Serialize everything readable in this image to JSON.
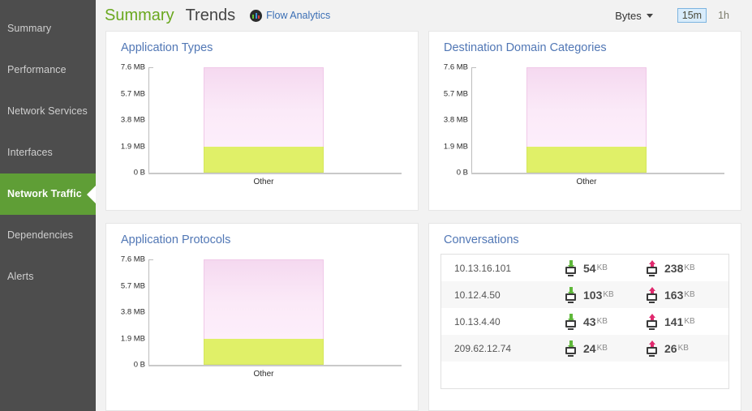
{
  "sidebar": {
    "items": [
      {
        "label": "Summary",
        "name": "summary",
        "active": false
      },
      {
        "label": "Performance",
        "name": "performance",
        "active": false
      },
      {
        "label": "Network Services",
        "name": "network-services",
        "active": false
      },
      {
        "label": "Interfaces",
        "name": "interfaces",
        "active": false
      },
      {
        "label": "Network Traffic",
        "name": "network-traffic",
        "active": true
      },
      {
        "label": "Dependencies",
        "name": "dependencies",
        "active": false
      },
      {
        "label": "Alerts",
        "name": "alerts",
        "active": false
      }
    ],
    "bg_color": "#4d4d4d",
    "active_color": "#5f9e36"
  },
  "header": {
    "tabs": [
      {
        "label": "Summary",
        "active": true
      },
      {
        "label": "Trends",
        "active": false
      }
    ],
    "flow_analytics": {
      "label": "Flow Analytics",
      "icon": "flow-analytics-icon"
    },
    "units": {
      "label": "Bytes",
      "icon": "chevron-down-icon"
    },
    "ranges": [
      {
        "label": "15m",
        "selected": true
      },
      {
        "label": "1h",
        "selected": false
      }
    ],
    "active_tab_color": "#6aa81f",
    "link_color": "#3b6fb5",
    "selected_range_bg": "#d9ecfb"
  },
  "panels": {
    "app_types": {
      "title": "Application Types"
    },
    "dest_domain": {
      "title": "Destination Domain Categories"
    },
    "app_proto": {
      "title": "Application Protocols"
    },
    "conversations": {
      "title": "Conversations"
    }
  },
  "chart_data": [
    {
      "id": "app-types",
      "type": "bar",
      "title": "Application Types",
      "stacked": true,
      "categories": [
        "Other"
      ],
      "series": [
        {
          "name": "segment-lower",
          "values": [
            1.9
          ],
          "color": "#e0f068"
        },
        {
          "name": "segment-upper",
          "values": [
            5.7
          ],
          "color": "#f8e2f4"
        }
      ],
      "totals": [
        7.6
      ],
      "ylabel": "",
      "xlabel": "",
      "ylim": [
        0,
        7.6
      ],
      "yticks": [
        "0 B",
        "1.9 MB",
        "3.8 MB",
        "5.7 MB",
        "7.6 MB"
      ],
      "ytick_values": [
        0,
        1.9,
        3.8,
        5.7,
        7.6
      ],
      "units": "MB",
      "grid": false,
      "legend": "none"
    },
    {
      "id": "dest-domain",
      "type": "bar",
      "title": "Destination Domain Categories",
      "stacked": true,
      "categories": [
        "Other"
      ],
      "series": [
        {
          "name": "segment-lower",
          "values": [
            1.9
          ],
          "color": "#e0f068"
        },
        {
          "name": "segment-upper",
          "values": [
            5.7
          ],
          "color": "#f8e2f4"
        }
      ],
      "totals": [
        7.6
      ],
      "ylabel": "",
      "xlabel": "",
      "ylim": [
        0,
        7.6
      ],
      "yticks": [
        "0 B",
        "1.9 MB",
        "3.8 MB",
        "5.7 MB",
        "7.6 MB"
      ],
      "ytick_values": [
        0,
        1.9,
        3.8,
        5.7,
        7.6
      ],
      "units": "MB",
      "grid": false,
      "legend": "none"
    },
    {
      "id": "app-proto",
      "type": "bar",
      "title": "Application Protocols",
      "stacked": true,
      "categories": [
        "Other"
      ],
      "series": [
        {
          "name": "segment-lower",
          "values": [
            1.9
          ],
          "color": "#e0f068"
        },
        {
          "name": "segment-upper",
          "values": [
            5.7
          ],
          "color": "#f8e2f4"
        }
      ],
      "totals": [
        7.6
      ],
      "ylabel": "",
      "xlabel": "",
      "ylim": [
        0,
        7.6
      ],
      "yticks": [
        "0 B",
        "1.9 MB",
        "3.8 MB",
        "5.7 MB",
        "7.6 MB"
      ],
      "ytick_values": [
        0,
        1.9,
        3.8,
        5.7,
        7.6
      ],
      "units": "MB",
      "grid": false,
      "legend": "none"
    }
  ],
  "conversations": {
    "rows": [
      {
        "host": "10.13.16.101",
        "down_value": "54",
        "down_unit": "KB",
        "up_value": "238",
        "up_unit": "KB"
      },
      {
        "host": "10.12.4.50",
        "down_value": "103",
        "down_unit": "KB",
        "up_value": "163",
        "up_unit": "KB"
      },
      {
        "host": "10.13.4.40",
        "down_value": "43",
        "down_unit": "KB",
        "up_value": "141",
        "up_unit": "KB"
      },
      {
        "host": "209.62.12.74",
        "down_value": "24",
        "down_unit": "KB",
        "up_value": "26",
        "up_unit": "KB"
      }
    ],
    "download_icon": "download-host-icon",
    "upload_icon": "upload-host-icon",
    "download_color": "#5fb83a",
    "upload_color": "#e02a6e"
  }
}
